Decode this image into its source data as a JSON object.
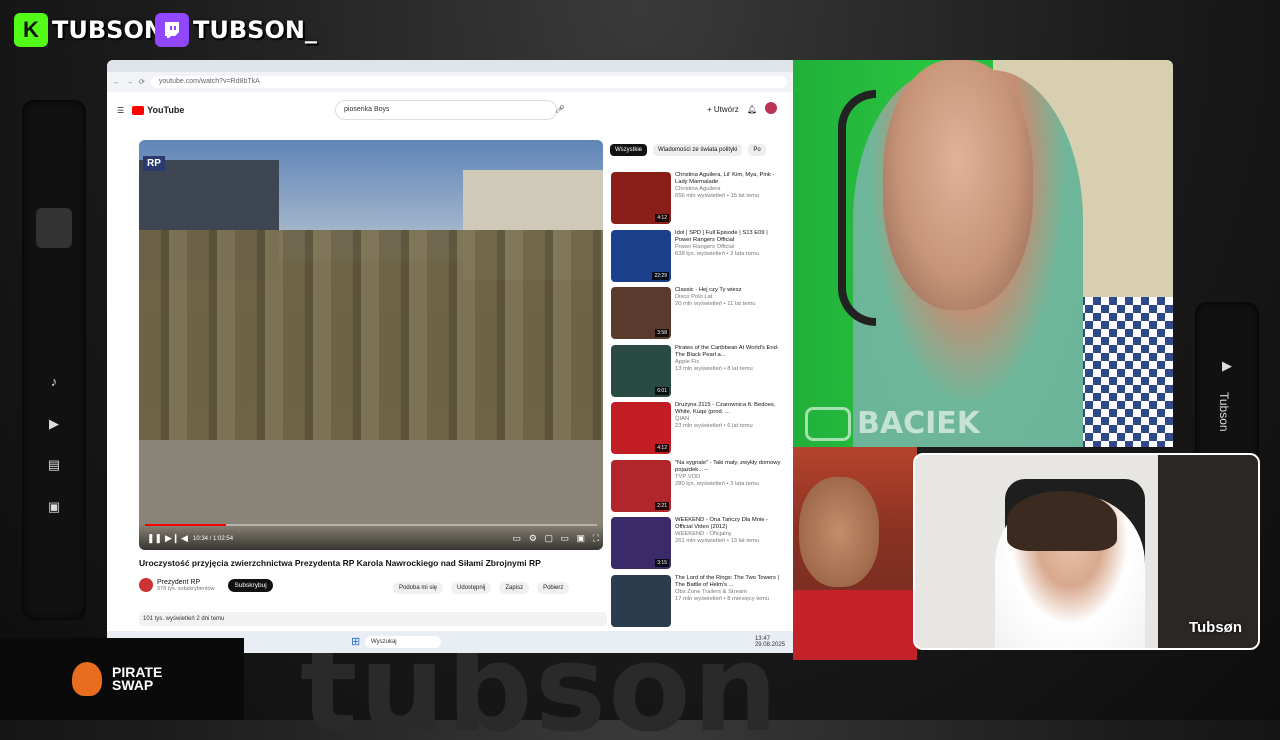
{
  "overlay": {
    "kick_handle": "TUBSON",
    "kick_icon": "K",
    "twitch_handle": "TUBSON_",
    "kick_color": "#53fc18",
    "twitch_color": "#9146ff",
    "side_label": "Tubson",
    "watermark": "tubson",
    "cam_watermark": "BACIEK",
    "cam_brand": "Tubsøn",
    "sponsor_line1": "PIRATE",
    "sponsor_line2": "SWAP"
  },
  "browser": {
    "url": "youtube.com/watch?v=Rd8bTkA",
    "search_text": "piosenka Boys",
    "brand": "YouTube",
    "create_label": "+ Utwórz"
  },
  "player": {
    "badge": "RP",
    "time": "10:34 / 1:02:54",
    "progress": 0.18,
    "title": "Uroczystość przyjęcia zwierzchnictwa Prezydenta RP Karola Nawrockiego nad Siłami Zbrojnymi RP",
    "channel": "Prezydent RP",
    "subscribers": "978 tys. subskrybentów",
    "subscribe": "Subskrybuj",
    "like": "Podoba mi się",
    "share": "Udostępnij",
    "save": "Zapisz",
    "download": "Pobierz",
    "description": "101 tys. wyświetleń  2 dni temu"
  },
  "chips": {
    "all": "Wszystkie",
    "politics": "Wiadomości ze świata polityki",
    "more": "Po"
  },
  "recommendations": [
    {
      "title": "Christina Aguilera, Lil' Kim, Mya, Pink - Lady Marmalade",
      "channel": "Christina Aguilera",
      "stats": "656 mln wyświetleń • 15 lat temu",
      "duration": "4:12",
      "color": "#8a1f1a"
    },
    {
      "title": "Idol | SPD | Full Episode | S13 E09 | Power Rangers Official",
      "channel": "Power Rangers Official",
      "stats": "638 tys. wyświetleń • 2 lata temu",
      "duration": "22:29",
      "color": "#1b3f8a"
    },
    {
      "title": "Classic - Hej czy Ty wiesz",
      "channel": "Disco Polo Lat",
      "stats": "20 mln wyświetleń • 11 lat temu",
      "duration": "3:58",
      "color": "#5a3a2c"
    },
    {
      "title": "Pirates of the Caribbean At World's End-The Black Pearl a...",
      "channel": "Apple Fix",
      "stats": "13 mln wyświetleń • 8 lat temu",
      "duration": "6:01",
      "color": "#2a4a44"
    },
    {
      "title": "Drużyna 2115 - Czarownica ft. Bedoes, White, Kuqe (prod. ...",
      "channel": "QIAN",
      "stats": "23 mln wyświetleń • 6 lat temu",
      "duration": "4:12",
      "color": "#c31c22"
    },
    {
      "title": "\"Na sygnale\" - Taki mały, zwykły domowy pojazdek... –",
      "channel": "TVP VOD",
      "stats": "280 tys. wyświetleń • 3 lata temu",
      "duration": "2:21",
      "color": "#b0262a"
    },
    {
      "title": "WEEKEND - Ona Tańczy Dla Mnie - Official Video (2012)",
      "channel": "WEEKEND - Oficjalny",
      "stats": "261 mln wyświetleń • 13 lat temu",
      "duration": "3:15",
      "color": "#3a2a6a"
    },
    {
      "title": "The Lord of the Rings: The Two Towers | The Battle of Helm's ...",
      "channel": "Obs Zone Trailers & Stream",
      "stats": "17 mln wyświetleń • 8 miesięcy temu",
      "duration": "",
      "color": "#2a3c4e"
    }
  ],
  "taskbar": {
    "search": "Wyszukaj",
    "clock": "13:47",
    "date": "29.08.2025"
  }
}
